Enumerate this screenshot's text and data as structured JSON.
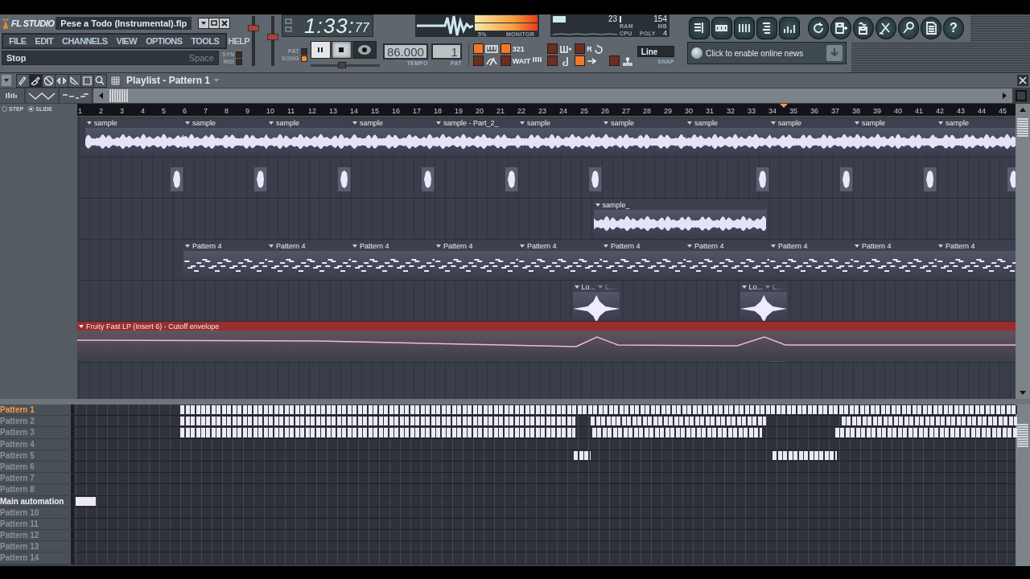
{
  "app": {
    "logo": "FL STUDIO",
    "file_title": "Pese a Todo (Instrumental).flp"
  },
  "menu": [
    "FILE",
    "EDIT",
    "CHANNELS",
    "VIEW",
    "OPTIONS",
    "TOOLS",
    "HELP"
  ],
  "hint": {
    "text": "Stop",
    "shortcut": "Space"
  },
  "toggles": [
    {
      "label": "SYN",
      "on": false
    },
    {
      "label": "MDI",
      "on": false
    }
  ],
  "master_sliders": [
    {
      "level": 0.8
    },
    {
      "level": 0.6
    }
  ],
  "song_position": {
    "level": 0.45
  },
  "time": {
    "main": "1:33:",
    "small": "77"
  },
  "transport": {
    "modes": [
      {
        "label": "PAT",
        "selected": false
      },
      {
        "label": "SONG",
        "selected": true
      }
    ],
    "buttons": [
      {
        "kind": "pause",
        "pressed": false
      },
      {
        "kind": "stop",
        "pressed": true
      },
      {
        "kind": "record",
        "pressed": false
      }
    ],
    "tempo": "86.000",
    "tempo_label": "TEMPO",
    "pattern": "1",
    "pattern_label": "PAT"
  },
  "monitor": {
    "value": "5%",
    "label": "MONITOR"
  },
  "cpu": {
    "ram": "23",
    "ram_label": "RAM",
    "memory": "154",
    "memory_label": "MB",
    "cpu_label": "CPU",
    "poly_label": "POLY",
    "poly": "4"
  },
  "record_options": [
    {
      "kind": "keyboard",
      "on": true
    },
    {
      "kind": "countdown",
      "on": true,
      "label": "321"
    },
    {
      "kind": "step",
      "on": false
    },
    {
      "kind": "loop",
      "on": false,
      "label": "R"
    },
    {
      "kind": "metronome",
      "on": false
    },
    {
      "kind": "wait",
      "on": false,
      "label": "WAIT"
    },
    {
      "kind": "note",
      "on": false
    },
    {
      "kind": "arrow",
      "on": true
    },
    {
      "kind": "joystick",
      "on": false
    }
  ],
  "snap": {
    "value": "Line",
    "label": "SNAP"
  },
  "window_buttons": [
    {
      "kind": "playlist"
    },
    {
      "kind": "sequencer"
    },
    {
      "kind": "piano"
    },
    {
      "kind": "browser"
    },
    {
      "kind": "mixer"
    }
  ],
  "tool_buttons": [
    {
      "kind": "refresh"
    },
    {
      "kind": "save"
    },
    {
      "kind": "export"
    },
    {
      "kind": "cut"
    },
    {
      "kind": "microphone"
    },
    {
      "kind": "document"
    },
    {
      "kind": "help",
      "label": "?"
    }
  ],
  "news": {
    "text": "Click to enable online news"
  },
  "playlist": {
    "title": "Playlist - Pattern 1",
    "tools": [
      {
        "kind": "draw",
        "selected": false
      },
      {
        "kind": "paint",
        "selected": true
      },
      {
        "kind": "mute",
        "selected": false
      },
      {
        "kind": "slip",
        "selected": false
      },
      {
        "kind": "slice",
        "selected": false
      },
      {
        "kind": "select",
        "selected": false
      },
      {
        "kind": "zoom",
        "selected": false
      }
    ],
    "snap_modes": [
      {
        "label": "STEP",
        "selected": false
      },
      {
        "label": "SLIDE",
        "selected": true
      }
    ],
    "ruler": [
      "1",
      "2",
      "3",
      "4",
      "5",
      "6",
      "7",
      "8",
      "9",
      "10",
      "11",
      "12",
      "13",
      "14",
      "15",
      "16",
      "17",
      "18",
      "19",
      "20",
      "21",
      "22",
      "23",
      "24",
      "25",
      "26",
      "27",
      "28",
      "29",
      "30",
      "31",
      "32",
      "33",
      "34",
      "35",
      "36",
      "37",
      "38",
      "39",
      "40",
      "41",
      "42",
      "43",
      "44",
      "45"
    ],
    "tracks": [
      {
        "kind": "audio",
        "clips": [
          {
            "label": "sample"
          },
          {
            "label": "sample"
          },
          {
            "label": "sample"
          },
          {
            "label": "sample"
          },
          {
            "label": "sample - Part_2_"
          },
          {
            "label": "sample"
          },
          {
            "label": "sample"
          },
          {
            "label": "sample"
          },
          {
            "label": "sample"
          },
          {
            "label": "sample"
          },
          {
            "label": "sample"
          }
        ]
      },
      {
        "kind": "hits"
      },
      {
        "kind": "audio",
        "clips": [
          {
            "label": "sample_"
          }
        ]
      },
      {
        "kind": "pattern",
        "clips": [
          {
            "label": "Pattern 4"
          },
          {
            "label": "Pattern 4"
          },
          {
            "label": "Pattern 4"
          },
          {
            "label": "Pattern 4"
          },
          {
            "label": "Pattern 4"
          },
          {
            "label": "Pattern 4"
          },
          {
            "label": "Pattern 4"
          },
          {
            "label": "Pattern 4"
          },
          {
            "label": "Pattern 4"
          },
          {
            "label": "Pattern 4"
          }
        ]
      },
      {
        "kind": "burst",
        "clips": [
          {
            "label": "Lo...",
            "label_2": "L..."
          },
          {
            "label": "Lo...",
            "label_2": "L..."
          }
        ]
      },
      {
        "kind": "automation",
        "clips": [
          {
            "label": "Fruity Fast LP (Insert 6) - Cutoff envelope"
          }
        ]
      }
    ],
    "patterns": [
      {
        "label": "Pattern 1",
        "kind": "pattern",
        "selected": true
      },
      {
        "label": "Pattern 2",
        "kind": "pattern",
        "selected": false
      },
      {
        "label": "Pattern 3",
        "kind": "pattern",
        "selected": false
      },
      {
        "label": "Pattern 4",
        "kind": "pattern",
        "selected": false
      },
      {
        "label": "Pattern 5",
        "kind": "pattern",
        "selected": false
      },
      {
        "label": "Pattern 6",
        "kind": "pattern",
        "selected": false
      },
      {
        "label": "Pattern 7",
        "kind": "pattern",
        "selected": false
      },
      {
        "label": "Pattern 8",
        "kind": "pattern",
        "selected": false
      },
      {
        "label": "Main automation",
        "kind": "automation",
        "selected": false
      },
      {
        "label": "Pattern 10",
        "kind": "pattern",
        "selected": false
      },
      {
        "label": "Pattern 11",
        "kind": "pattern",
        "selected": false
      },
      {
        "label": "Pattern 12",
        "kind": "pattern",
        "selected": false
      },
      {
        "label": "Pattern 13",
        "kind": "pattern",
        "selected": false
      },
      {
        "label": "Pattern 14",
        "kind": "pattern",
        "selected": false
      }
    ]
  }
}
